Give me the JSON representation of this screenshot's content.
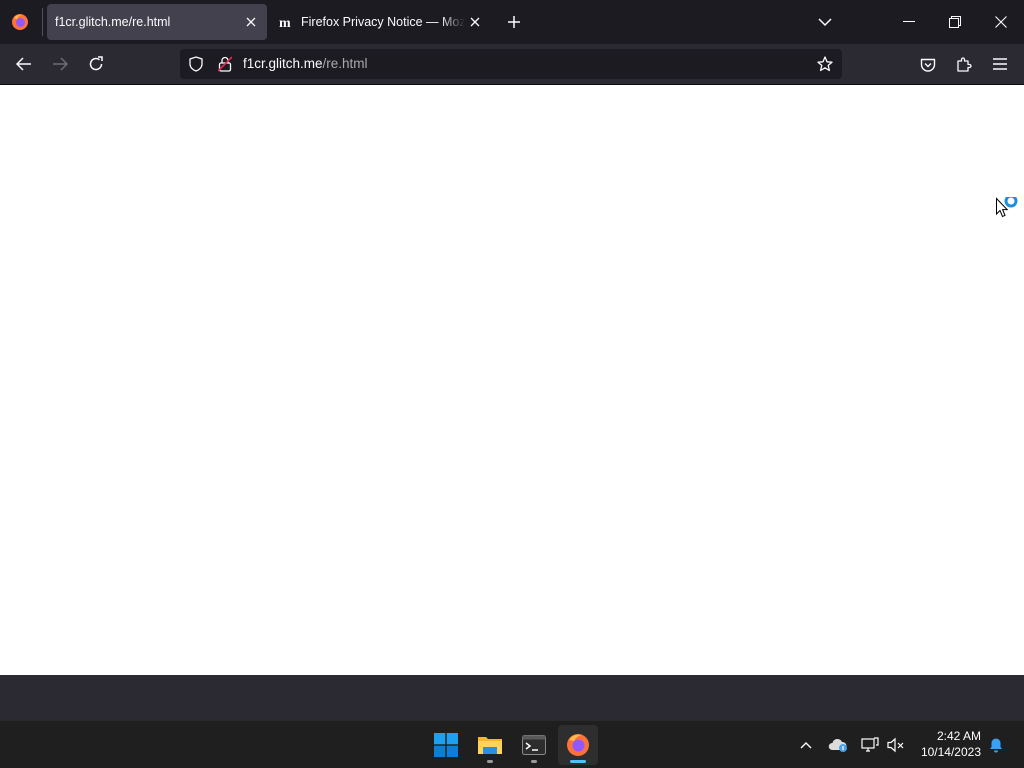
{
  "browser": {
    "tabs": [
      {
        "title": "f1cr.glitch.me/re.html",
        "active": true,
        "favicon": "none"
      },
      {
        "title": "Firefox Privacy Notice — Mozilla",
        "active": false,
        "favicon": "mozilla-m-icon"
      }
    ],
    "urlbar": {
      "host": "f1cr.glitch.me",
      "path": "/re.html"
    }
  },
  "taskbar": {
    "apps": [
      "windows-start",
      "file-explorer",
      "terminal",
      "firefox"
    ],
    "clock": {
      "time": "2:42 AM",
      "date": "10/14/2023"
    }
  },
  "colors": {
    "accent": "#0078d4",
    "tab_active": "#42414d",
    "toolbar": "#2b2a33",
    "tabstrip": "#1c1b22"
  }
}
